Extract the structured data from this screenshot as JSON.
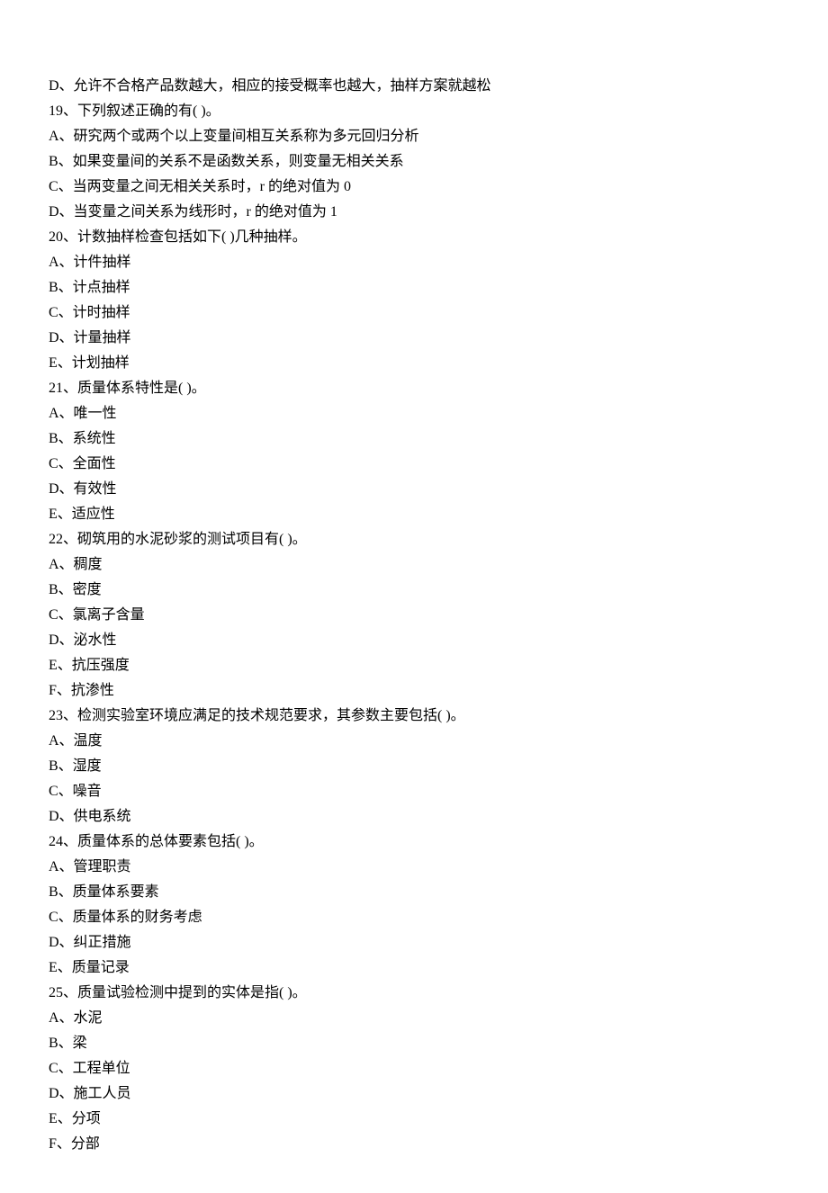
{
  "lines": [
    "D、允许不合格产品数越大，相应的接受概率也越大，抽样方案就越松",
    "19、下列叙述正确的有( )。",
    "A、研究两个或两个以上变量间相互关系称为多元回归分析",
    "B、如果变量间的关系不是函数关系，则变量无相关关系",
    "C、当两变量之间无相关关系时，r 的绝对值为 0",
    "D、当变量之间关系为线形时，r 的绝对值为 1",
    "20、计数抽样检查包括如下( )几种抽样。",
    "A、计件抽样",
    "B、计点抽样",
    "C、计时抽样",
    "D、计量抽样",
    "E、计划抽样",
    "21、质量体系特性是( )。",
    "A、唯一性",
    "B、系统性",
    "C、全面性",
    "D、有效性",
    "E、适应性",
    "22、砌筑用的水泥砂浆的测试项目有( )。",
    "A、稠度",
    "B、密度",
    "C、氯离子含量",
    "D、泌水性",
    "E、抗压强度",
    "F、抗渗性",
    "23、检测实验室环境应满足的技术规范要求，其参数主要包括( )。",
    "A、温度",
    "B、湿度",
    "C、噪音",
    "D、供电系统",
    "24、质量体系的总体要素包括( )。",
    "A、管理职责",
    "B、质量体系要素",
    "C、质量体系的财务考虑",
    "D、纠正措施",
    "E、质量记录",
    "25、质量试验检测中提到的实体是指( )。",
    "A、水泥",
    "B、梁",
    "C、工程单位",
    "D、施工人员",
    "E、分项",
    "F、分部"
  ]
}
